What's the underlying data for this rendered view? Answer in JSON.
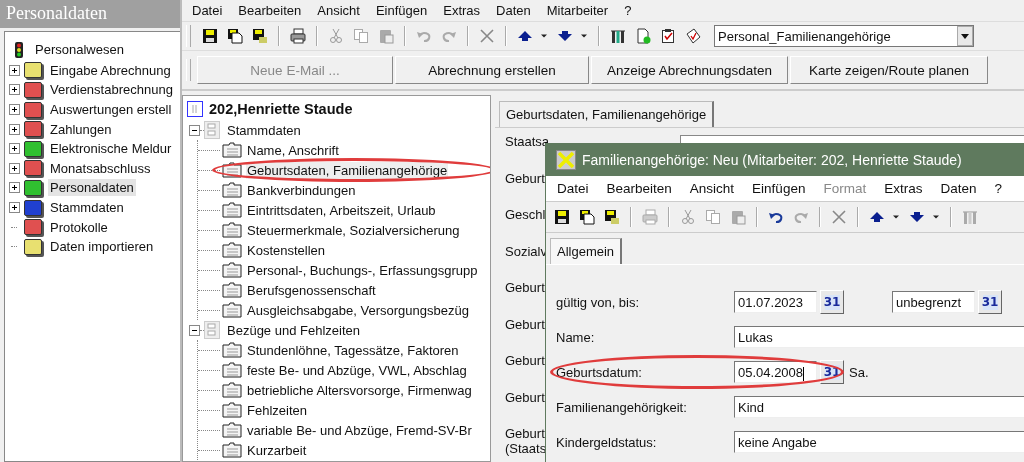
{
  "sidebar": {
    "title": "Personaldaten",
    "tree": {
      "label": "Personalwesen",
      "children": [
        {
          "label": "Eingabe Abrechnung",
          "expanded": false,
          "selected": false,
          "color": "#e8e070"
        },
        {
          "label": "Verdienstabrechnung",
          "expanded": false,
          "selected": false,
          "color": "#e05050"
        },
        {
          "label": "Auswertungen erstell",
          "expanded": false,
          "selected": false,
          "color": "#e05050"
        },
        {
          "label": "Zahlungen",
          "expanded": false,
          "selected": false,
          "color": "#e05050"
        },
        {
          "label": "Elektronische Meldur",
          "expanded": false,
          "selected": false,
          "color": "#30c030"
        },
        {
          "label": "Monatsabschluss",
          "expanded": false,
          "selected": false,
          "color": "#e05050"
        },
        {
          "label": "Personaldaten",
          "expanded": false,
          "selected": true,
          "color": "#30c030"
        },
        {
          "label": "Stammdaten",
          "expanded": false,
          "selected": false,
          "color": "#2040d0"
        },
        {
          "label": "Protokolle",
          "selected": false,
          "color": "#e05050"
        },
        {
          "label": "Daten importieren",
          "selected": false,
          "color": "#e8e070"
        }
      ]
    }
  },
  "menu": [
    {
      "label": "Datei",
      "disabled": false
    },
    {
      "label": "Bearbeiten",
      "disabled": false
    },
    {
      "label": "Ansicht",
      "disabled": false
    },
    {
      "label": "Einfügen",
      "disabled": false
    },
    {
      "label": "Extras",
      "disabled": false
    },
    {
      "label": "Daten",
      "disabled": false
    },
    {
      "label": "Mitarbeiter",
      "disabled": false
    },
    {
      "label": "?",
      "disabled": false
    }
  ],
  "toolbar": {
    "combo": "Personal_Familienangehörige"
  },
  "action_buttons": [
    {
      "label": "Neue E-Mail ...",
      "disabled": true
    },
    {
      "label": "Abrechnung erstellen",
      "disabled": false
    },
    {
      "label": "Anzeige Abrechnungsdaten",
      "disabled": false
    },
    {
      "label": "Karte zeigen/Route planen",
      "disabled": false
    }
  ],
  "employee_tree": {
    "label": "202,Henriette Staude",
    "groups": [
      {
        "label": "Stammdaten",
        "expanded": true,
        "children": [
          {
            "label": "Name, Anschrift",
            "selected": false,
            "circled": false
          },
          {
            "label": "Geburtsdaten, Familienangehörige",
            "selected": true,
            "circled": true
          },
          {
            "label": "Bankverbindungen",
            "selected": false,
            "circled": false
          },
          {
            "label": "Eintrittsdaten, Arbeitszeit, Urlaub",
            "selected": false,
            "circled": false
          },
          {
            "label": "Steuermerkmale, Sozialversicherung",
            "selected": false,
            "circled": false
          },
          {
            "label": "Kostenstellen",
            "selected": false,
            "circled": false
          },
          {
            "label": "Personal-, Buchungs-, Erfassungsgrupp",
            "selected": false,
            "circled": false
          },
          {
            "label": "Berufsgenossenschaft",
            "selected": false,
            "circled": false
          },
          {
            "label": "Ausgleichsabgabe, Versorgungsbezüg",
            "selected": false,
            "circled": false
          }
        ]
      },
      {
        "label": "Bezüge und Fehlzeiten",
        "expanded": true,
        "children": [
          {
            "label": "Stundenlöhne, Tagessätze, Faktoren",
            "selected": false,
            "circled": false
          },
          {
            "label": "feste Be- und Abzüge, VWL, Abschlag",
            "selected": false,
            "circled": false
          },
          {
            "label": "betriebliche Altersvorsorge, Firmenwag",
            "selected": false,
            "circled": false
          },
          {
            "label": "Fehlzeiten",
            "selected": false,
            "circled": false
          },
          {
            "label": "variable Be- und Abzüge, Fremd-SV-Br",
            "selected": false,
            "circled": false
          },
          {
            "label": "Kurzarbeit",
            "selected": false,
            "circled": false
          }
        ]
      }
    ]
  },
  "detail": {
    "tab": "Geburtsdaten, Familienangehörige",
    "labels": [
      "Staatsa",
      "Geburt",
      "Geschl",
      "Sozialv",
      "Geburt",
      "Geburt",
      "Geburt",
      "Geburt",
      "Geburt (Staats"
    ]
  },
  "dialog": {
    "title": "Familienangehörige: Neu (Mitarbeiter: 202, Henriette Staude)",
    "menu": [
      {
        "label": "Datei",
        "disabled": false
      },
      {
        "label": "Bearbeiten",
        "disabled": false
      },
      {
        "label": "Ansicht",
        "disabled": false
      },
      {
        "label": "Einfügen",
        "disabled": false
      },
      {
        "label": "Format",
        "disabled": true
      },
      {
        "label": "Extras",
        "disabled": false
      },
      {
        "label": "Daten",
        "disabled": false
      },
      {
        "label": "?",
        "disabled": false
      }
    ],
    "tabs": [
      {
        "label": "Allgemein",
        "selected": true
      }
    ],
    "rows": [
      {
        "kind": "date-range",
        "label": "gültig von, bis:",
        "from": {
          "value": "01.07.2023",
          "calendar": "31"
        },
        "to": {
          "value": "unbegrenzt",
          "calendar": "31"
        },
        "circled": false
      },
      {
        "kind": "text",
        "label": "Name:",
        "value": "Lukas",
        "circled": false
      },
      {
        "kind": "date",
        "label": "Geburtsdatum:",
        "date": {
          "value": "05.04.2008",
          "calendar": "31"
        },
        "weekday": "Sa.",
        "circled": true
      },
      {
        "kind": "text",
        "label": "Familienangehörigkeit:",
        "value": "Kind",
        "circled": false
      },
      {
        "kind": "text",
        "label": "Kindergeldstatus:",
        "value": "keine Angabe",
        "circled": false
      }
    ]
  }
}
